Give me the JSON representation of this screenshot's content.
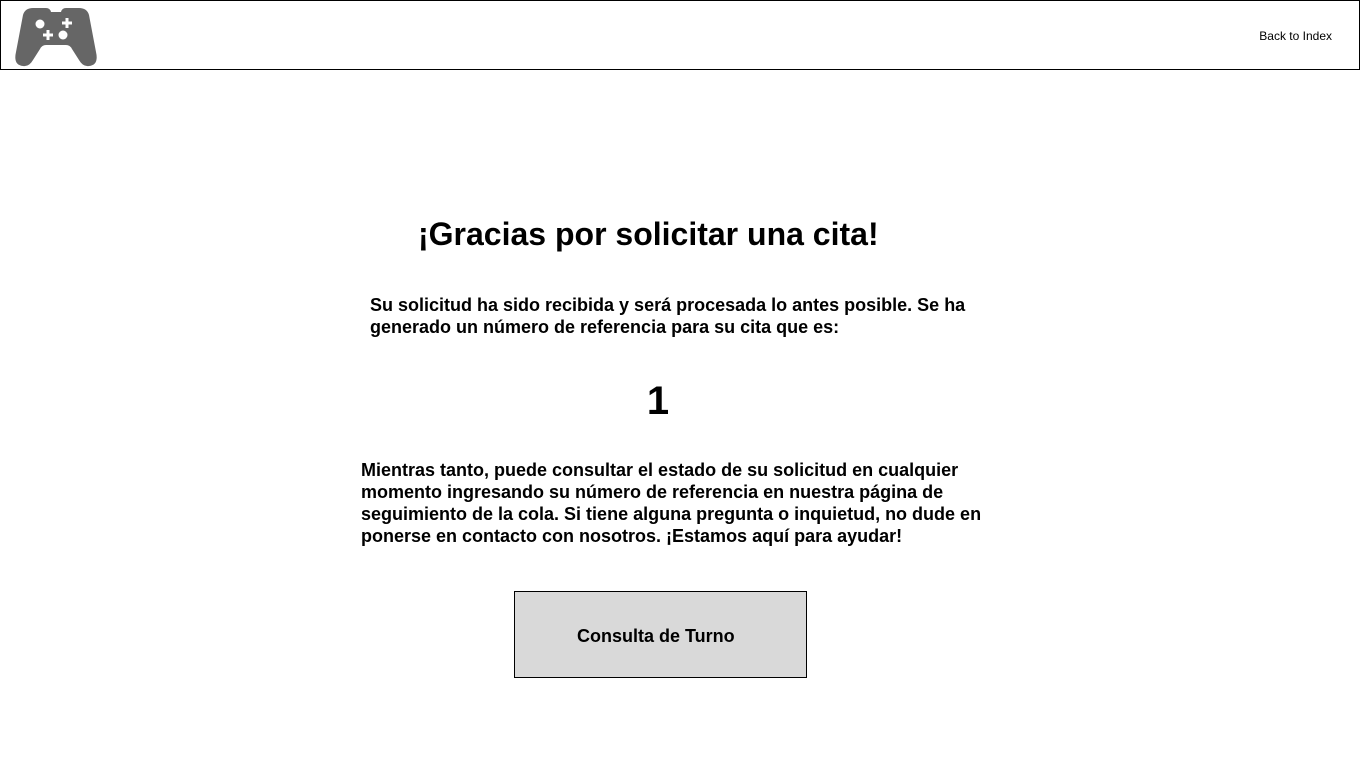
{
  "header": {
    "logo_icon": "gamepad-icon",
    "logo_color": "#666666",
    "back_link": "Back to Index"
  },
  "main": {
    "title": "¡Gracias por solicitar una cita!",
    "intro": "Su solicitud ha sido recibida y será procesada lo antes posible. Se ha generado un número de referencia para su cita que es:",
    "reference_number": "1",
    "details": "Mientras tanto, puede consultar el estado de su solicitud en cualquier momento ingresando su número de referencia en nuestra página de seguimiento de la cola. Si tiene alguna pregunta o inquietud, no dude en ponerse en contacto con nosotros. ¡Estamos aquí para ayudar!",
    "button_label": "Consulta de Turno"
  },
  "colors": {
    "button_background": "#d9d9d9",
    "border": "#000000",
    "text": "#000000"
  }
}
